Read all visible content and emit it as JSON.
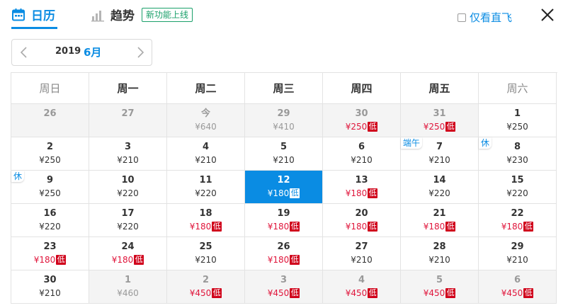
{
  "tabs": {
    "calendar": {
      "icon": "calendar-icon",
      "label": "日历"
    },
    "trend": {
      "icon": "bar-chart-icon",
      "label": "趋势",
      "badge": "新功能上线"
    }
  },
  "filter": {
    "direct_label": "仅看直飞",
    "checked": false
  },
  "close_icon": "close-icon",
  "nav": {
    "year": "2019",
    "month": "6月",
    "prev_icon": "chevron-left-icon",
    "next_icon": "chevron-right-icon"
  },
  "colors": {
    "accent": "#0a8ce3",
    "low_price": "#e0153b",
    "low_badge": "#d0021b",
    "new_badge": "#1aa06a"
  },
  "weekdays": [
    "周日",
    "周一",
    "周二",
    "周三",
    "周四",
    "周五",
    "周六"
  ],
  "weeks": [
    [
      {
        "day": "26",
        "price": "",
        "dim": true
      },
      {
        "day": "27",
        "price": "",
        "dim": true
      },
      {
        "day": "今",
        "price": "¥640",
        "dim": true
      },
      {
        "day": "29",
        "price": "¥410",
        "dim": true
      },
      {
        "day": "30",
        "price": "¥250",
        "low": true,
        "low_label": "低",
        "dim": true
      },
      {
        "day": "31",
        "price": "¥250",
        "low": true,
        "low_label": "低",
        "dim": true
      },
      {
        "day": "1",
        "price": "¥250"
      }
    ],
    [
      {
        "day": "2",
        "price": "¥250"
      },
      {
        "day": "3",
        "price": "¥210"
      },
      {
        "day": "4",
        "price": "¥210"
      },
      {
        "day": "5",
        "price": "¥210"
      },
      {
        "day": "6",
        "price": "¥210"
      },
      {
        "day": "7",
        "price": "¥210",
        "tag": "端午"
      },
      {
        "day": "8",
        "price": "¥230",
        "tag": "休"
      }
    ],
    [
      {
        "day": "9",
        "price": "¥250",
        "tag": "休"
      },
      {
        "day": "10",
        "price": "¥220"
      },
      {
        "day": "11",
        "price": "¥220"
      },
      {
        "day": "12",
        "price": "¥180",
        "low": true,
        "low_label": "低",
        "selected": true
      },
      {
        "day": "13",
        "price": "¥180",
        "low": true,
        "low_label": "低"
      },
      {
        "day": "14",
        "price": "¥220"
      },
      {
        "day": "15",
        "price": "¥220"
      }
    ],
    [
      {
        "day": "16",
        "price": "¥220"
      },
      {
        "day": "17",
        "price": "¥220"
      },
      {
        "day": "18",
        "price": "¥180",
        "low": true,
        "low_label": "低"
      },
      {
        "day": "19",
        "price": "¥180",
        "low": true,
        "low_label": "低"
      },
      {
        "day": "20",
        "price": "¥180",
        "low": true,
        "low_label": "低"
      },
      {
        "day": "21",
        "price": "¥180",
        "low": true,
        "low_label": "低"
      },
      {
        "day": "22",
        "price": "¥180",
        "low": true,
        "low_label": "低"
      }
    ],
    [
      {
        "day": "23",
        "price": "¥180",
        "low": true,
        "low_label": "低"
      },
      {
        "day": "24",
        "price": "¥180",
        "low": true,
        "low_label": "低"
      },
      {
        "day": "25",
        "price": "¥210"
      },
      {
        "day": "26",
        "price": "¥180",
        "low": true,
        "low_label": "低"
      },
      {
        "day": "27",
        "price": "¥210"
      },
      {
        "day": "28",
        "price": "¥210"
      },
      {
        "day": "29",
        "price": "¥210"
      }
    ],
    [
      {
        "day": "30",
        "price": "¥210"
      },
      {
        "day": "1",
        "price": "¥460",
        "dim": true
      },
      {
        "day": "2",
        "price": "¥450",
        "low": true,
        "low_label": "低",
        "dim": true
      },
      {
        "day": "3",
        "price": "¥450",
        "low": true,
        "low_label": "低",
        "dim": true
      },
      {
        "day": "4",
        "price": "¥450",
        "low": true,
        "low_label": "低",
        "dim": true
      },
      {
        "day": "5",
        "price": "¥450",
        "low": true,
        "low_label": "低",
        "dim": true
      },
      {
        "day": "6",
        "price": "¥450",
        "low": true,
        "low_label": "低",
        "dim": true
      }
    ]
  ]
}
